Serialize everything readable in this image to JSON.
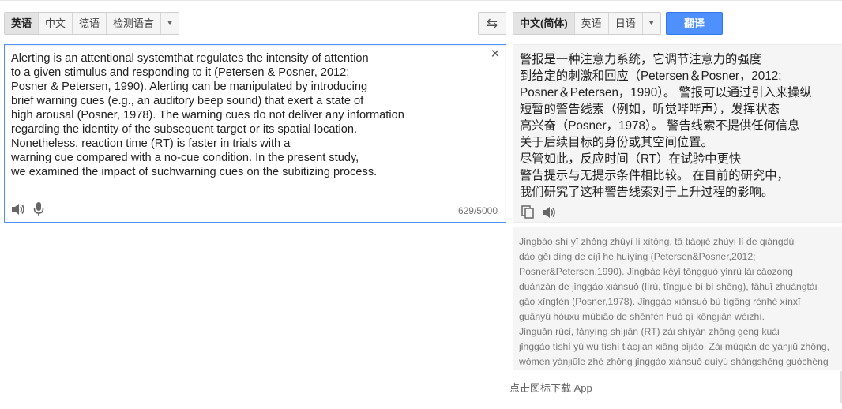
{
  "source_languages": {
    "items": [
      "英语",
      "中文",
      "德语",
      "检测语言"
    ],
    "active_index": 0
  },
  "target_languages": {
    "items": [
      "中文(简体)",
      "英语",
      "日语"
    ],
    "active_index": 0
  },
  "icons": {
    "dropdown": "chevron-down-icon",
    "swap": "swap-icon",
    "clear": "close-icon",
    "speaker": "speaker-icon",
    "mic": "microphone-icon",
    "copy": "copy-icon"
  },
  "swap_glyph": "⇆",
  "translate_button": "翻译",
  "clear_glyph": "×",
  "source": {
    "text": "Alerting is an attentional systemthat regulates the intensity of attention\nto a given stimulus and responding to it (Petersen & Posner, 2012;\nPosner & Petersen, 1990). Alerting can be manipulated by introducing\nbrief warning cues (e.g., an auditory beep sound) that exert a state of\nhigh arousal (Posner, 1978). The warning cues do not deliver any information\nregarding the identity of the subsequent target or its spatial location.\nNonetheless, reaction time (RT) is faster in trials with a\nwarning cue compared with a no-cue condition. In the present study,\nwe examined the impact of suchwarning cues on the subitizing process.",
    "char_count": "629/5000"
  },
  "result": {
    "text": "警报是一种注意力系统，它调节注意力的强度\n到给定的刺激和回应（Petersen＆Posner，2012;\nPosner＆Petersen，1990）。 警报可以通过引入来操纵\n短暂的警告线索（例如，听觉哔哔声），发挥状态\n高兴奋（Posner，1978）。 警告线索不提供任何信息\n关于后续目标的身份或其空间位置。\n尽管如此，反应时间（RT）在试验中更快\n警告提示与无提示条件相比较。 在目前的研究中，\n我们研究了这种警告线索对于上升过程的影响。"
  },
  "romanization": "Jǐngbào shì yī zhǒng zhùyì lì xìtǒng, tā tiáojié zhùyì lì de qiángdù\ndào gěi dìng de cìjī hé huíyìng (Petersen&Posner,2012;\nPosner&Petersen,1990). Jǐngbào kěyǐ tōngguò yǐnrù lái cāozòng\nduǎnzàn de jǐnggào xiànsuǒ (lìrú, tīngjué bì bì shēng), fāhuī zhuàngtài\ngāo xīngfèn (Posner,1978). Jǐnggào xiànsuǒ bù tígōng rènhé xìnxī\nguānyú hòuxù mùbiāo de shēnfèn huò qí kōngjiān wèizhì.\nJǐnguǎn rúcǐ, fǎnyìng shíjiān (RT) zài shìyàn zhōng gèng kuài\njǐnggào tíshì yǔ wú tíshì tiáojiàn xiāng bǐjiào. Zài mùqián de yánjiū zhōng,\nwǒmen yánjiūle zhè zhǒng jǐnggào xiànsuǒ duìyú shàngshēng guòchéng",
  "download_link": "点击图标下载 App",
  "colors": {
    "accent": "#4d90fe",
    "result_bg": "#f5f5f5"
  }
}
